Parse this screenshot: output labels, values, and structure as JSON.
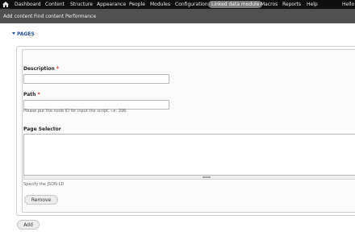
{
  "toolbar": {
    "home_icon": "home-icon",
    "items": [
      {
        "label": "Dashboard"
      },
      {
        "label": "Content"
      },
      {
        "label": "Structure"
      },
      {
        "label": "Appearance"
      },
      {
        "label": "People"
      },
      {
        "label": "Modules"
      },
      {
        "label": "Configuration"
      },
      {
        "label": "Linked data module",
        "active": true
      },
      {
        "label": "Macros"
      },
      {
        "label": "Reports"
      },
      {
        "label": "Help"
      }
    ],
    "user_greeting": "Hello"
  },
  "shortcuts": [
    {
      "label": "Add content"
    },
    {
      "label": "Find content"
    },
    {
      "label": "Performance"
    }
  ],
  "fieldset": {
    "legend": "PAGES"
  },
  "form": {
    "description": {
      "label": "Description",
      "required_mark": "*",
      "value": ""
    },
    "path": {
      "label": "Path",
      "required_mark": "*",
      "value": "",
      "help": "Please put the node ID for input the script, i.e: 398."
    },
    "page_selector": {
      "label": "Page Selector",
      "value": "",
      "help": "Specify the JSON-LD"
    },
    "remove_label": "Remove"
  },
  "add_label": "Add",
  "colors": {
    "toolbar_bg": "#0f0f0f",
    "shortcuts_bg": "#505050",
    "active_item_bg": "#7a7a7a",
    "legend_color": "#1f4fa2",
    "required_color": "#c4261d"
  }
}
